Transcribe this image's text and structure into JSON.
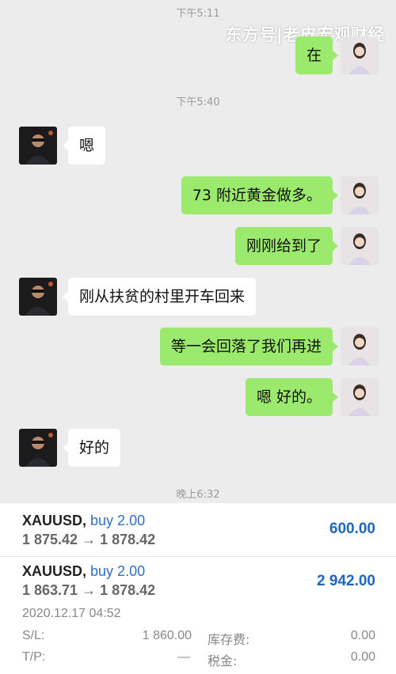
{
  "chat": {
    "timestamps": [
      "下午5:11",
      "下午5:40",
      "晚上6:32"
    ],
    "watermark": "东方号|老皮宏观财经",
    "messages": [
      {
        "side": "right",
        "text": "在"
      },
      {
        "side": "left",
        "text": "嗯"
      },
      {
        "side": "right",
        "text": "73 附近黄金做多。"
      },
      {
        "side": "right",
        "text": "刚刚给到了"
      },
      {
        "side": "left",
        "text": "刚从扶贫的村里开车回来"
      },
      {
        "side": "right",
        "text": "等一会回落了我们再进"
      },
      {
        "side": "right",
        "text": "嗯 好的。"
      },
      {
        "side": "left",
        "text": "好的"
      }
    ]
  },
  "trades": [
    {
      "symbol": "XAUUSD,",
      "action": "buy 2.00",
      "open_price": "1 875.42",
      "arrow": "→",
      "close_price": "1 878.42",
      "profit": "600.00"
    },
    {
      "symbol": "XAUUSD,",
      "action": "buy 2.00",
      "open_price": "1 863.71",
      "arrow": "→",
      "close_price": "1 878.42",
      "profit": "2 942.00",
      "date": "2020.12.17 04:52",
      "sl_label": "S/L:",
      "sl_value": "1 860.00",
      "tp_label": "T/P:",
      "tp_value": "—",
      "swap_label": "库存费:",
      "swap_value": "0.00",
      "tax_label": "税金:",
      "tax_value": "0.00"
    }
  ],
  "colors": {
    "bubble_right": "#9bea6d",
    "bubble_left": "#ffffff",
    "chat_bg": "#ececec",
    "buy_blue": "#2f6fc4",
    "profit_blue": "#1e66c4"
  }
}
